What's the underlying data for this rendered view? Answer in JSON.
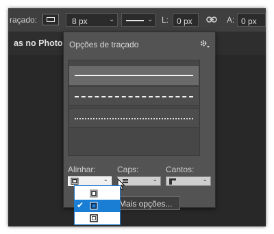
{
  "options_bar": {
    "stroke_label": "raçado:",
    "stroke_width": "8 px",
    "width_label": "L:",
    "width_value": "0 px",
    "height_label": "A:",
    "height_value": "0 px"
  },
  "document_tab": {
    "title": "as no Photos"
  },
  "stroke_panel": {
    "title": "Opções de traçado",
    "line_styles": [
      "solid",
      "dashed",
      "dotted"
    ],
    "selected_style": "solid",
    "align_label": "Alinhar:",
    "caps_label": "Caps:",
    "corners_label": "Cantos:",
    "more_options_label": "Mais opções...",
    "align_menu": {
      "options": [
        "inside",
        "center",
        "outside"
      ],
      "selected": "center"
    }
  },
  "colors": {
    "panel_bg": "#535353",
    "menu_highlight": "#1a7fd4",
    "app_bg": "#282828"
  }
}
